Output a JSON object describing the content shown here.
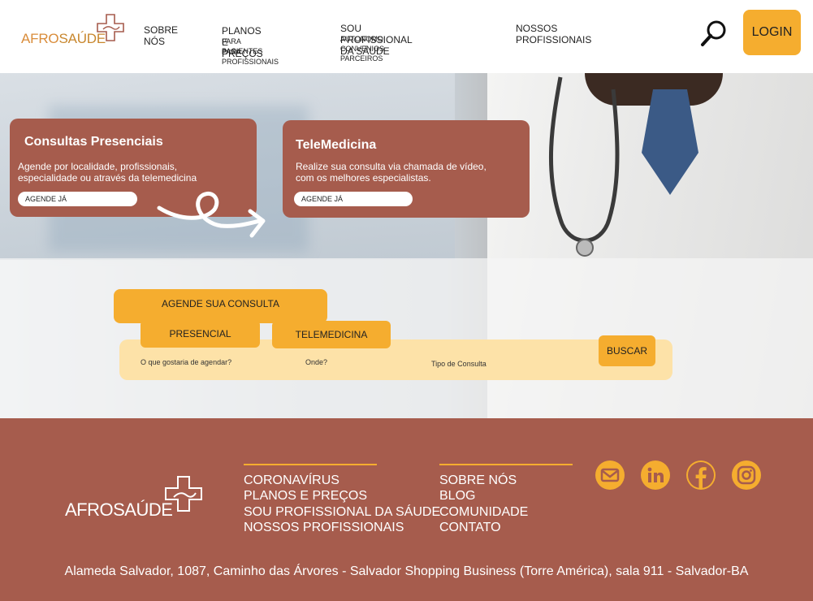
{
  "header": {
    "logo_afro": "AFRO",
    "logo_saude": "SAÚDE",
    "nav": {
      "sobre": "SOBRE NÓS",
      "planos": "PLANOS E PREÇOS",
      "planos_sub1": "PARA PACIENTES",
      "planos_sub2": "PARA PROFISSIONAIS",
      "profissional": "SOU PROFISSIONAL DA SÁUDE",
      "profissional_sub1": "AUTONOMO",
      "profissional_sub2": "CONVENIOS PARCEIROS",
      "nossos": "NOSSOS PROFISSIONAIS"
    },
    "login_label": "LOGIN"
  },
  "cards": [
    {
      "title": "Consultas Presenciais",
      "text1": "Agende por localidade, profissionais,",
      "text2": "especialidade ou através da telemedicina",
      "button": "AGENDE JÁ"
    },
    {
      "title": "TeleMedicina",
      "text1": "Realize sua consulta via chamada de vídeo,",
      "text2": "com os melhores especialistas.",
      "button": "AGENDE JÁ"
    }
  ],
  "booking": {
    "main_tab": "AGENDE SUA CONSULTA",
    "tab_presencial": "PRESENCIAL",
    "tab_telemedicina": "TELEMEDICINA",
    "field_what": "O que gostaria de agendar?",
    "field_where": "Onde?",
    "field_type": "Tipo de Consulta",
    "search_button": "BUSCAR"
  },
  "footer": {
    "logo_text": "AFROSAÚDE",
    "col1": [
      "CORONAVÍRUS",
      "PLANOS E PREÇOS",
      "SOU PROFISSIONAL DA SÁUDE",
      "NOSSOS PROFISSIONAIS"
    ],
    "col2": [
      "SOBRE NÓS",
      "BLOG",
      "COMUNIDADE",
      "CONTATO"
    ],
    "address": "Alameda Salvador, 1087, Caminho das Árvores - Salvador Shopping Business (Torre América), sala 911 - Salvador-BA",
    "social_icons": [
      "email-icon",
      "linkedin-icon",
      "facebook-icon",
      "instagram-icon"
    ]
  },
  "colors": {
    "accent": "#f5ad2f",
    "brand": "#a65c4d",
    "light_accent": "#fde2a8"
  }
}
